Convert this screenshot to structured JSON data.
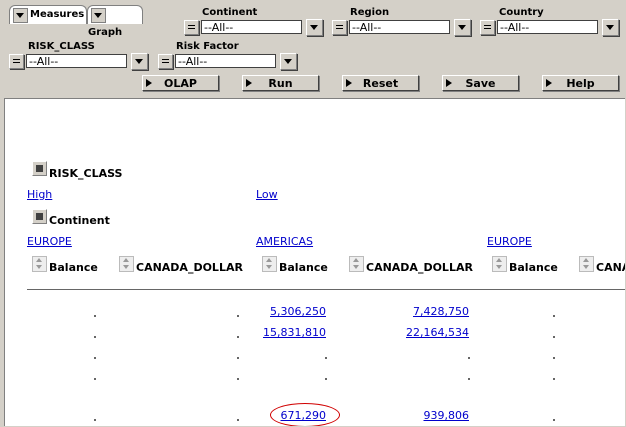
{
  "tabs": [
    {
      "label": "Measures"
    },
    {
      "label": "Graph"
    }
  ],
  "filters": {
    "continent": {
      "label": "Continent",
      "value": "--All--"
    },
    "region": {
      "label": "Region",
      "value": "--All--"
    },
    "country": {
      "label": "Country",
      "value": "--All--"
    },
    "risk_class": {
      "label": "RISK_CLASS",
      "value": "--All--"
    },
    "risk_factor": {
      "label": "Risk Factor",
      "value": "--All--"
    }
  },
  "actions": {
    "olap": "OLAP",
    "run": "Run",
    "reset": "Reset",
    "save": "Save",
    "help": "Help"
  },
  "report": {
    "risk_class_header": "RISK_CLASS",
    "continent_header": "Continent",
    "risk_values": [
      "High",
      "Low"
    ],
    "continents": [
      "EUROPE",
      "AMERICAS",
      "EUROPE"
    ],
    "measure_headers": [
      "Balance",
      "CANADA_DOLLAR",
      "Balance",
      "CANADA_DOLLAR",
      "Balance",
      "CANADA_DOLLAR"
    ],
    "rows": [
      {
        "americas_balance": "5,306,250",
        "americas_cad": "7,428,750"
      },
      {
        "americas_balance": "15,831,810",
        "americas_cad": "22,164,534"
      },
      {
        "americas_balance": "",
        "americas_cad": ""
      },
      {
        "americas_balance": "",
        "americas_cad": ""
      },
      {
        "americas_balance": "671,290",
        "americas_cad": "939,806"
      }
    ]
  },
  "colors": {
    "background": "#d4d0c8",
    "link": "#0000cc",
    "highlight_circle": "#d00000"
  }
}
